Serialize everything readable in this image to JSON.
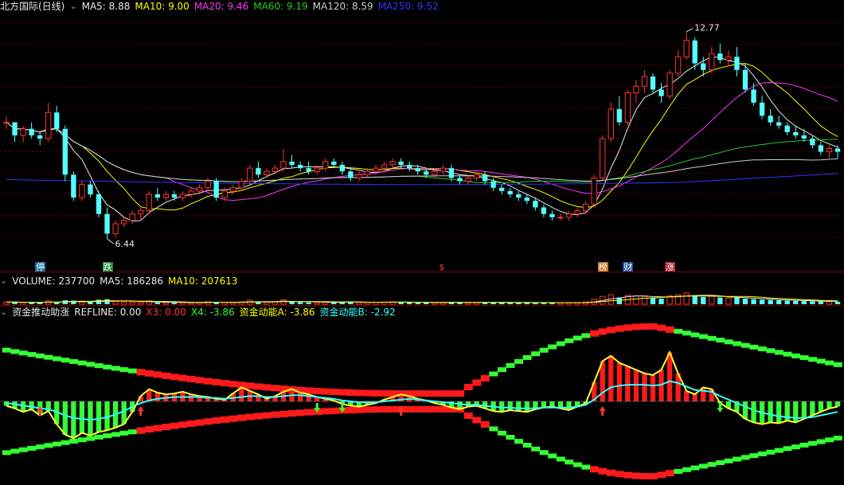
{
  "colors": {
    "up": "#ff3333",
    "down": "#54ffff",
    "ma5": "#e8e8e8",
    "ma10": "#ffff00",
    "ma20": "#ff33ff",
    "ma60": "#22cc22",
    "ma120": "#cccccc",
    "ma250": "#3333ff",
    "red_bar": "#ff1a1a",
    "green_bar": "#33ff33",
    "yellow_line": "#ffff33",
    "cyan_line": "#33ffff",
    "arrow_up": "#ff3333",
    "arrow_down": "#33ff33"
  },
  "price_panel": {
    "title": "北方国际(日线)",
    "indicators": [
      {
        "label": "MA5:",
        "value": "8.88",
        "color": "#e8e8e8"
      },
      {
        "label": "MA10:",
        "value": "9.00",
        "color": "#ffff00"
      },
      {
        "label": "MA20:",
        "value": "9.46",
        "color": "#ff33ff"
      },
      {
        "label": "MA60:",
        "value": "9.19",
        "color": "#22cc22"
      },
      {
        "label": "MA120:",
        "value": "8.59",
        "color": "#cccccc"
      },
      {
        "label": "MA250:",
        "value": "9.52",
        "color": "#3333ff"
      }
    ],
    "high_label": "12.77",
    "low_label": "6.44",
    "markers": [
      {
        "text": "停",
        "bg": "#1e6fa0",
        "fg": "#ffffff"
      },
      {
        "text": "跌",
        "bg": "#1e8a3a",
        "fg": "#ffffff"
      },
      {
        "text": "$",
        "bg": "",
        "fg": "#ff3333"
      },
      {
        "text": "榜",
        "bg": "#c07a2a",
        "fg": "#ffffff"
      },
      {
        "text": "财",
        "bg": "#1e4fa0",
        "fg": "#ffffff"
      },
      {
        "text": "涨",
        "bg": "#a01e2a",
        "fg": "#ffffff"
      }
    ]
  },
  "volume_panel": {
    "title": "VOLUME: 237700",
    "indicators": [
      {
        "label": "MA5:",
        "value": "186286",
        "color": "#e8e8e8"
      },
      {
        "label": "MA10:",
        "value": "207613",
        "color": "#ffff00"
      }
    ]
  },
  "indicator_panel": {
    "title": "资金推动助涨",
    "indicators": [
      {
        "label": "REFLINE:",
        "value": "0.00",
        "color": "#e8e8e8"
      },
      {
        "label": "X3:",
        "value": "0.00",
        "color": "#ff3333"
      },
      {
        "label": "X4:",
        "value": "-3.86",
        "color": "#33ff33"
      },
      {
        "label": "资金动能A:",
        "value": "-3.86",
        "color": "#ffff00"
      },
      {
        "label": "资金动能B:",
        "value": "-2.92",
        "color": "#33ffff"
      }
    ]
  },
  "chart_data": {
    "type": "candlestick",
    "high_marker": 12.77,
    "low_marker": 6.44,
    "ylim": [
      6.0,
      13.2
    ],
    "ohlc": [
      [
        10.0,
        10.2,
        9.8,
        10.0
      ],
      [
        10.0,
        10.0,
        9.4,
        9.6
      ],
      [
        9.6,
        9.9,
        9.4,
        9.8
      ],
      [
        9.8,
        10.0,
        9.5,
        9.6
      ],
      [
        9.6,
        9.7,
        9.3,
        9.5
      ],
      [
        9.5,
        10.6,
        9.4,
        10.3
      ],
      [
        10.3,
        10.5,
        9.7,
        9.8
      ],
      [
        9.8,
        9.9,
        8.2,
        8.4
      ],
      [
        8.4,
        8.5,
        7.6,
        7.7
      ],
      [
        7.7,
        8.2,
        7.6,
        8.1
      ],
      [
        8.1,
        8.2,
        7.7,
        7.8
      ],
      [
        7.8,
        7.9,
        7.1,
        7.2
      ],
      [
        7.2,
        7.4,
        6.44,
        6.6
      ],
      [
        6.6,
        7.0,
        6.5,
        6.9
      ],
      [
        6.9,
        7.1,
        6.8,
        7.0
      ],
      [
        7.0,
        7.3,
        6.9,
        7.2
      ],
      [
        7.2,
        7.4,
        7.0,
        7.3
      ],
      [
        7.3,
        7.9,
        7.2,
        7.8
      ],
      [
        7.8,
        8.0,
        7.6,
        7.7
      ],
      [
        7.7,
        7.9,
        7.6,
        7.8
      ],
      [
        7.8,
        7.9,
        7.6,
        7.7
      ],
      [
        7.7,
        7.9,
        7.6,
        7.8
      ],
      [
        7.8,
        8.0,
        7.7,
        7.9
      ],
      [
        7.9,
        8.1,
        7.8,
        8.0
      ],
      [
        8.0,
        8.3,
        7.9,
        8.2
      ],
      [
        8.2,
        8.3,
        7.6,
        7.7
      ],
      [
        7.7,
        8.0,
        7.6,
        7.9
      ],
      [
        7.9,
        8.1,
        7.8,
        8.0
      ],
      [
        8.0,
        8.3,
        7.9,
        8.2
      ],
      [
        8.2,
        8.7,
        8.1,
        8.6
      ],
      [
        8.6,
        8.8,
        8.3,
        8.4
      ],
      [
        8.4,
        8.6,
        8.3,
        8.5
      ],
      [
        8.5,
        8.7,
        8.4,
        8.6
      ],
      [
        8.6,
        9.2,
        8.5,
        8.8
      ],
      [
        8.8,
        9.0,
        8.6,
        8.7
      ],
      [
        8.7,
        8.8,
        8.5,
        8.6
      ],
      [
        8.6,
        8.8,
        8.4,
        8.5
      ],
      [
        8.5,
        8.7,
        8.4,
        8.6
      ],
      [
        8.6,
        8.9,
        8.5,
        8.8
      ],
      [
        8.8,
        8.9,
        8.6,
        8.7
      ],
      [
        8.7,
        8.8,
        8.4,
        8.5
      ],
      [
        8.5,
        8.6,
        8.2,
        8.3
      ],
      [
        8.3,
        8.5,
        8.2,
        8.4
      ],
      [
        8.4,
        8.6,
        8.3,
        8.5
      ],
      [
        8.5,
        8.7,
        8.4,
        8.6
      ],
      [
        8.6,
        8.8,
        8.5,
        8.7
      ],
      [
        8.7,
        8.9,
        8.6,
        8.8
      ],
      [
        8.8,
        8.9,
        8.6,
        8.7
      ],
      [
        8.7,
        8.8,
        8.5,
        8.6
      ],
      [
        8.6,
        8.7,
        8.4,
        8.5
      ],
      [
        8.5,
        8.6,
        8.3,
        8.4
      ],
      [
        8.4,
        8.6,
        8.3,
        8.5
      ],
      [
        8.5,
        8.7,
        8.4,
        8.6
      ],
      [
        8.6,
        8.7,
        8.2,
        8.3
      ],
      [
        8.3,
        8.4,
        8.1,
        8.2
      ],
      [
        8.2,
        8.4,
        8.1,
        8.3
      ],
      [
        8.3,
        8.5,
        8.2,
        8.4
      ],
      [
        8.4,
        8.5,
        8.1,
        8.2
      ],
      [
        8.2,
        8.3,
        7.9,
        8.0
      ],
      [
        8.0,
        8.1,
        7.8,
        7.9
      ],
      [
        7.9,
        8.0,
        7.7,
        7.8
      ],
      [
        7.8,
        7.9,
        7.6,
        7.7
      ],
      [
        7.7,
        7.8,
        7.5,
        7.6
      ],
      [
        7.6,
        7.7,
        7.3,
        7.4
      ],
      [
        7.4,
        7.5,
        7.1,
        7.2
      ],
      [
        7.2,
        7.3,
        7.0,
        7.1
      ],
      [
        7.1,
        7.2,
        7.0,
        7.1
      ],
      [
        7.1,
        7.3,
        7.0,
        7.2
      ],
      [
        7.2,
        7.4,
        7.1,
        7.3
      ],
      [
        7.3,
        7.6,
        7.2,
        7.5
      ],
      [
        7.5,
        8.4,
        7.4,
        8.3
      ],
      [
        8.3,
        9.6,
        8.2,
        9.5
      ],
      [
        9.5,
        10.6,
        9.4,
        10.4
      ],
      [
        10.4,
        10.8,
        9.9,
        10.0
      ],
      [
        10.0,
        11.0,
        9.9,
        10.9
      ],
      [
        10.9,
        11.3,
        10.6,
        11.1
      ],
      [
        11.1,
        11.6,
        10.9,
        11.4
      ],
      [
        11.4,
        11.5,
        10.9,
        11.0
      ],
      [
        11.0,
        11.2,
        10.6,
        10.8
      ],
      [
        10.8,
        11.6,
        10.7,
        11.5
      ],
      [
        11.5,
        12.2,
        11.4,
        12.0
      ],
      [
        12.0,
        12.77,
        11.9,
        12.5
      ],
      [
        12.5,
        12.6,
        11.6,
        11.8
      ],
      [
        11.8,
        12.0,
        11.4,
        11.6
      ],
      [
        11.6,
        12.3,
        11.5,
        12.1
      ],
      [
        12.1,
        12.4,
        11.8,
        11.9
      ],
      [
        11.9,
        12.2,
        11.7,
        12.0
      ],
      [
        12.0,
        12.3,
        11.4,
        11.6
      ],
      [
        11.6,
        11.8,
        10.9,
        11.0
      ],
      [
        11.0,
        11.2,
        10.5,
        10.6
      ],
      [
        10.6,
        10.8,
        10.1,
        10.2
      ],
      [
        10.2,
        10.4,
        9.9,
        10.0
      ],
      [
        10.0,
        10.2,
        9.8,
        9.9
      ],
      [
        9.9,
        10.0,
        9.6,
        9.7
      ],
      [
        9.7,
        9.9,
        9.5,
        9.6
      ],
      [
        9.6,
        9.8,
        9.4,
        9.5
      ],
      [
        9.5,
        9.6,
        9.2,
        9.3
      ],
      [
        9.3,
        9.4,
        9.0,
        9.1
      ],
      [
        9.1,
        9.3,
        8.9,
        9.2
      ],
      [
        9.2,
        9.3,
        8.9,
        9.1
      ]
    ],
    "volume": [
      0.2,
      0.18,
      0.15,
      0.16,
      0.14,
      0.3,
      0.18,
      0.35,
      0.32,
      0.2,
      0.22,
      0.4,
      0.45,
      0.25,
      0.2,
      0.18,
      0.16,
      0.3,
      0.15,
      0.14,
      0.13,
      0.14,
      0.16,
      0.18,
      0.22,
      0.2,
      0.15,
      0.16,
      0.2,
      0.35,
      0.25,
      0.18,
      0.2,
      0.4,
      0.22,
      0.18,
      0.16,
      0.15,
      0.2,
      0.18,
      0.22,
      0.2,
      0.16,
      0.15,
      0.18,
      0.2,
      0.22,
      0.18,
      0.16,
      0.15,
      0.14,
      0.15,
      0.16,
      0.18,
      0.16,
      0.15,
      0.16,
      0.15,
      0.18,
      0.16,
      0.14,
      0.13,
      0.14,
      0.15,
      0.16,
      0.13,
      0.12,
      0.13,
      0.15,
      0.2,
      0.45,
      0.7,
      0.85,
      0.6,
      0.8,
      0.75,
      0.7,
      0.55,
      0.5,
      0.75,
      0.85,
      1.0,
      0.8,
      0.65,
      0.7,
      0.6,
      0.55,
      0.6,
      0.5,
      0.45,
      0.4,
      0.38,
      0.35,
      0.32,
      0.3,
      0.28,
      0.26,
      0.25,
      0.24,
      0.22
    ],
    "momentum_a": [
      -0.5,
      -0.8,
      -1.2,
      -0.9,
      -1.6,
      -1.1,
      -2.6,
      -3.8,
      -4.2,
      -3.6,
      -3.9,
      -3.5,
      -3.3,
      -3.0,
      -2.6,
      -1.2,
      0.6,
      1.4,
      1.0,
      0.8,
      0.9,
      1.1,
      0.8,
      0.6,
      0.5,
      0.3,
      0.2,
      0.9,
      1.6,
      1.2,
      0.8,
      0.3,
      0.6,
      1.1,
      1.4,
      1.0,
      0.8,
      0.5,
      0.3,
      0.1,
      -0.3,
      -0.5,
      -0.6,
      -0.4,
      -0.2,
      0.2,
      0.5,
      0.8,
      0.6,
      0.3,
      0.1,
      -0.2,
      -0.4,
      -0.7,
      -0.9,
      -0.6,
      -0.5,
      -0.8,
      -1.1,
      -1.2,
      -1.0,
      -1.1,
      -1.2,
      -0.9,
      -0.7,
      -0.6,
      -0.8,
      -1.0,
      -0.6,
      -0.2,
      2.2,
      4.6,
      5.2,
      4.4,
      4.0,
      3.6,
      3.2,
      3.0,
      3.6,
      5.6,
      3.2,
      1.2,
      0.8,
      1.6,
      1.4,
      -0.2,
      -0.8,
      -1.2,
      -2.0,
      -2.4,
      -2.6,
      -2.4,
      -2.5,
      -2.2,
      -2.4,
      -2.0,
      -1.6,
      -1.2,
      -0.8,
      -0.6
    ],
    "momentum_b": [
      -0.2,
      -0.3,
      -0.5,
      -0.6,
      -0.8,
      -0.9,
      -1.2,
      -1.6,
      -1.9,
      -2.0,
      -2.1,
      -2.0,
      -1.8,
      -1.5,
      -1.1,
      -0.6,
      -0.2,
      0.1,
      0.3,
      0.4,
      0.5,
      0.5,
      0.5,
      0.5,
      0.4,
      0.4,
      0.3,
      0.4,
      0.5,
      0.6,
      0.6,
      0.5,
      0.5,
      0.6,
      0.7,
      0.7,
      0.6,
      0.5,
      0.4,
      0.3,
      0.1,
      0.0,
      -0.1,
      -0.1,
      -0.1,
      0.0,
      0.1,
      0.2,
      0.3,
      0.2,
      0.1,
      0.0,
      -0.1,
      -0.2,
      -0.3,
      -0.4,
      -0.4,
      -0.5,
      -0.6,
      -0.7,
      -0.7,
      -0.8,
      -0.8,
      -0.8,
      -0.7,
      -0.7,
      -0.7,
      -0.7,
      -0.6,
      -0.4,
      0.2,
      1.0,
      1.6,
      1.8,
      1.9,
      1.9,
      1.9,
      1.8,
      1.9,
      2.3,
      2.1,
      1.7,
      1.3,
      1.2,
      1.1,
      0.6,
      0.2,
      -0.2,
      -0.6,
      -1.0,
      -1.3,
      -1.5,
      -1.7,
      -1.8,
      -1.9,
      -1.9,
      -1.8,
      -1.6,
      -1.4,
      -1.2
    ],
    "x": [],
    "series": []
  }
}
